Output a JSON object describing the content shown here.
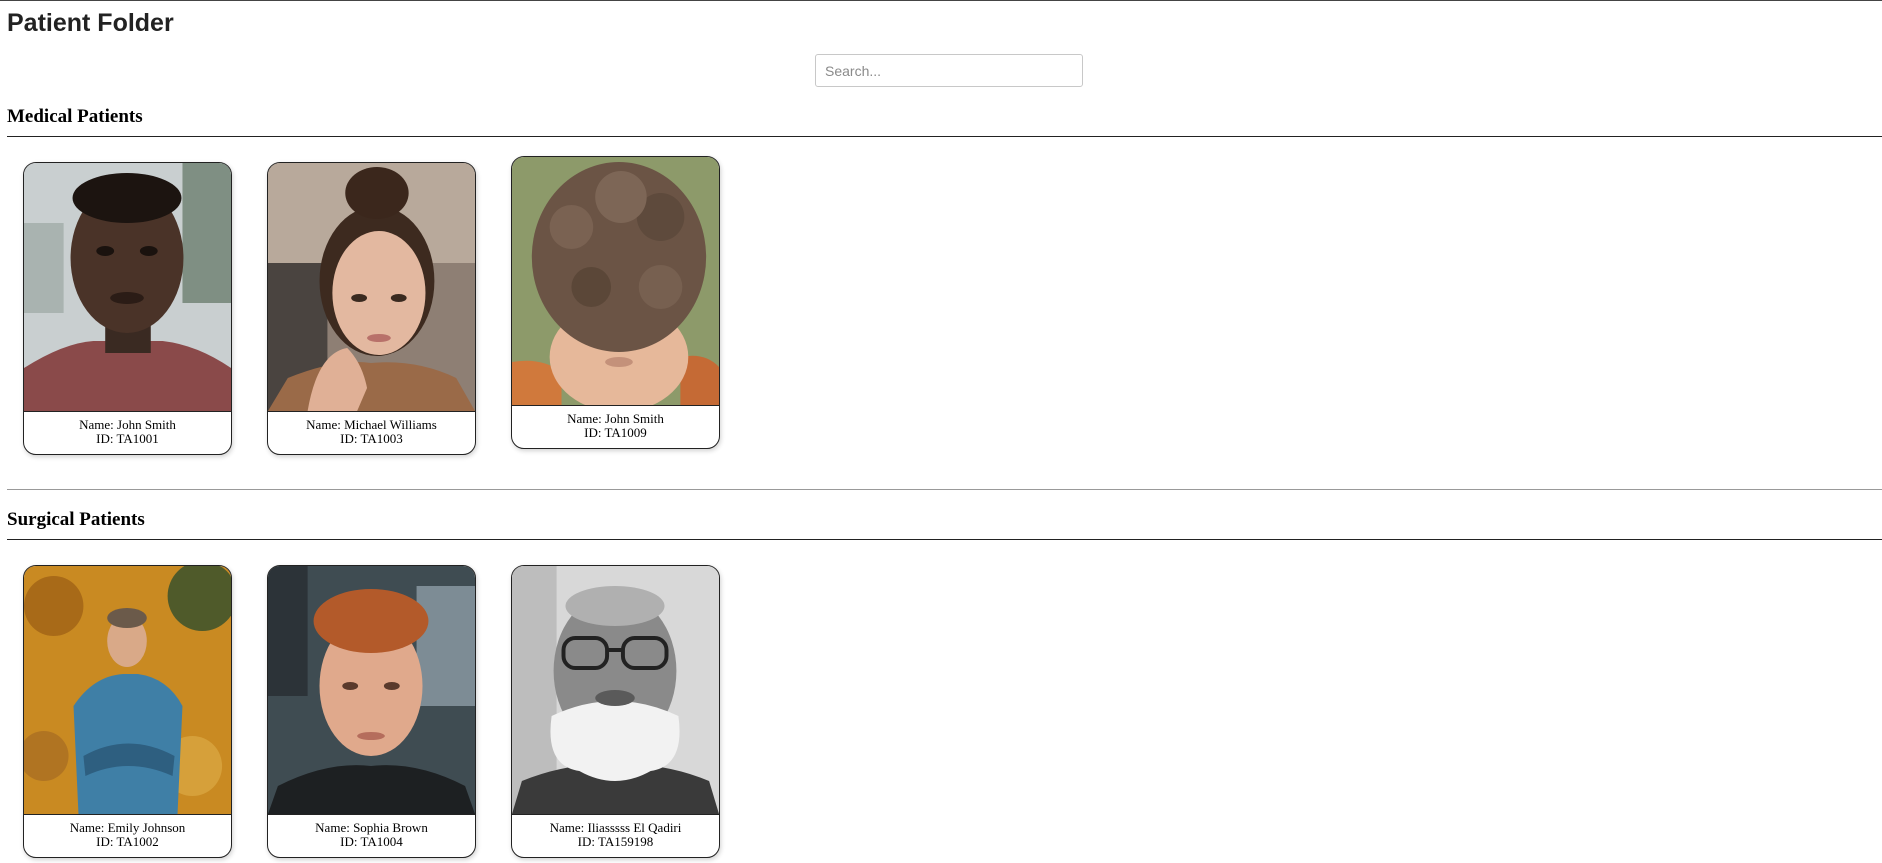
{
  "page": {
    "title": "Patient Folder"
  },
  "search": {
    "placeholder": "Search..."
  },
  "sections": [
    {
      "title": "Medical Patients",
      "patients": [
        {
          "name": "Name: John Smith",
          "id": "ID: TA1001",
          "photo": "portrait-young-man-dark-skin"
        },
        {
          "name": "Name: Michael Williams",
          "id": "ID: TA1003",
          "photo": "portrait-young-woman-freckles"
        },
        {
          "name": "Name: John Smith",
          "id": "ID: TA1009",
          "photo": "portrait-child-curly-hair"
        }
      ]
    },
    {
      "title": "Surgical Patients",
      "patients": [
        {
          "name": "Name: Emily Johnson",
          "id": "ID: TA1002",
          "photo": "portrait-teen-autumn-leaves"
        },
        {
          "name": "Name: Sophia Brown",
          "id": "ID: TA1004",
          "photo": "portrait-red-haired-man"
        },
        {
          "name": "Name: Iliasssss El Qadiri",
          "id": "ID: TA159198",
          "photo": "portrait-elderly-bearded-man"
        }
      ]
    }
  ]
}
